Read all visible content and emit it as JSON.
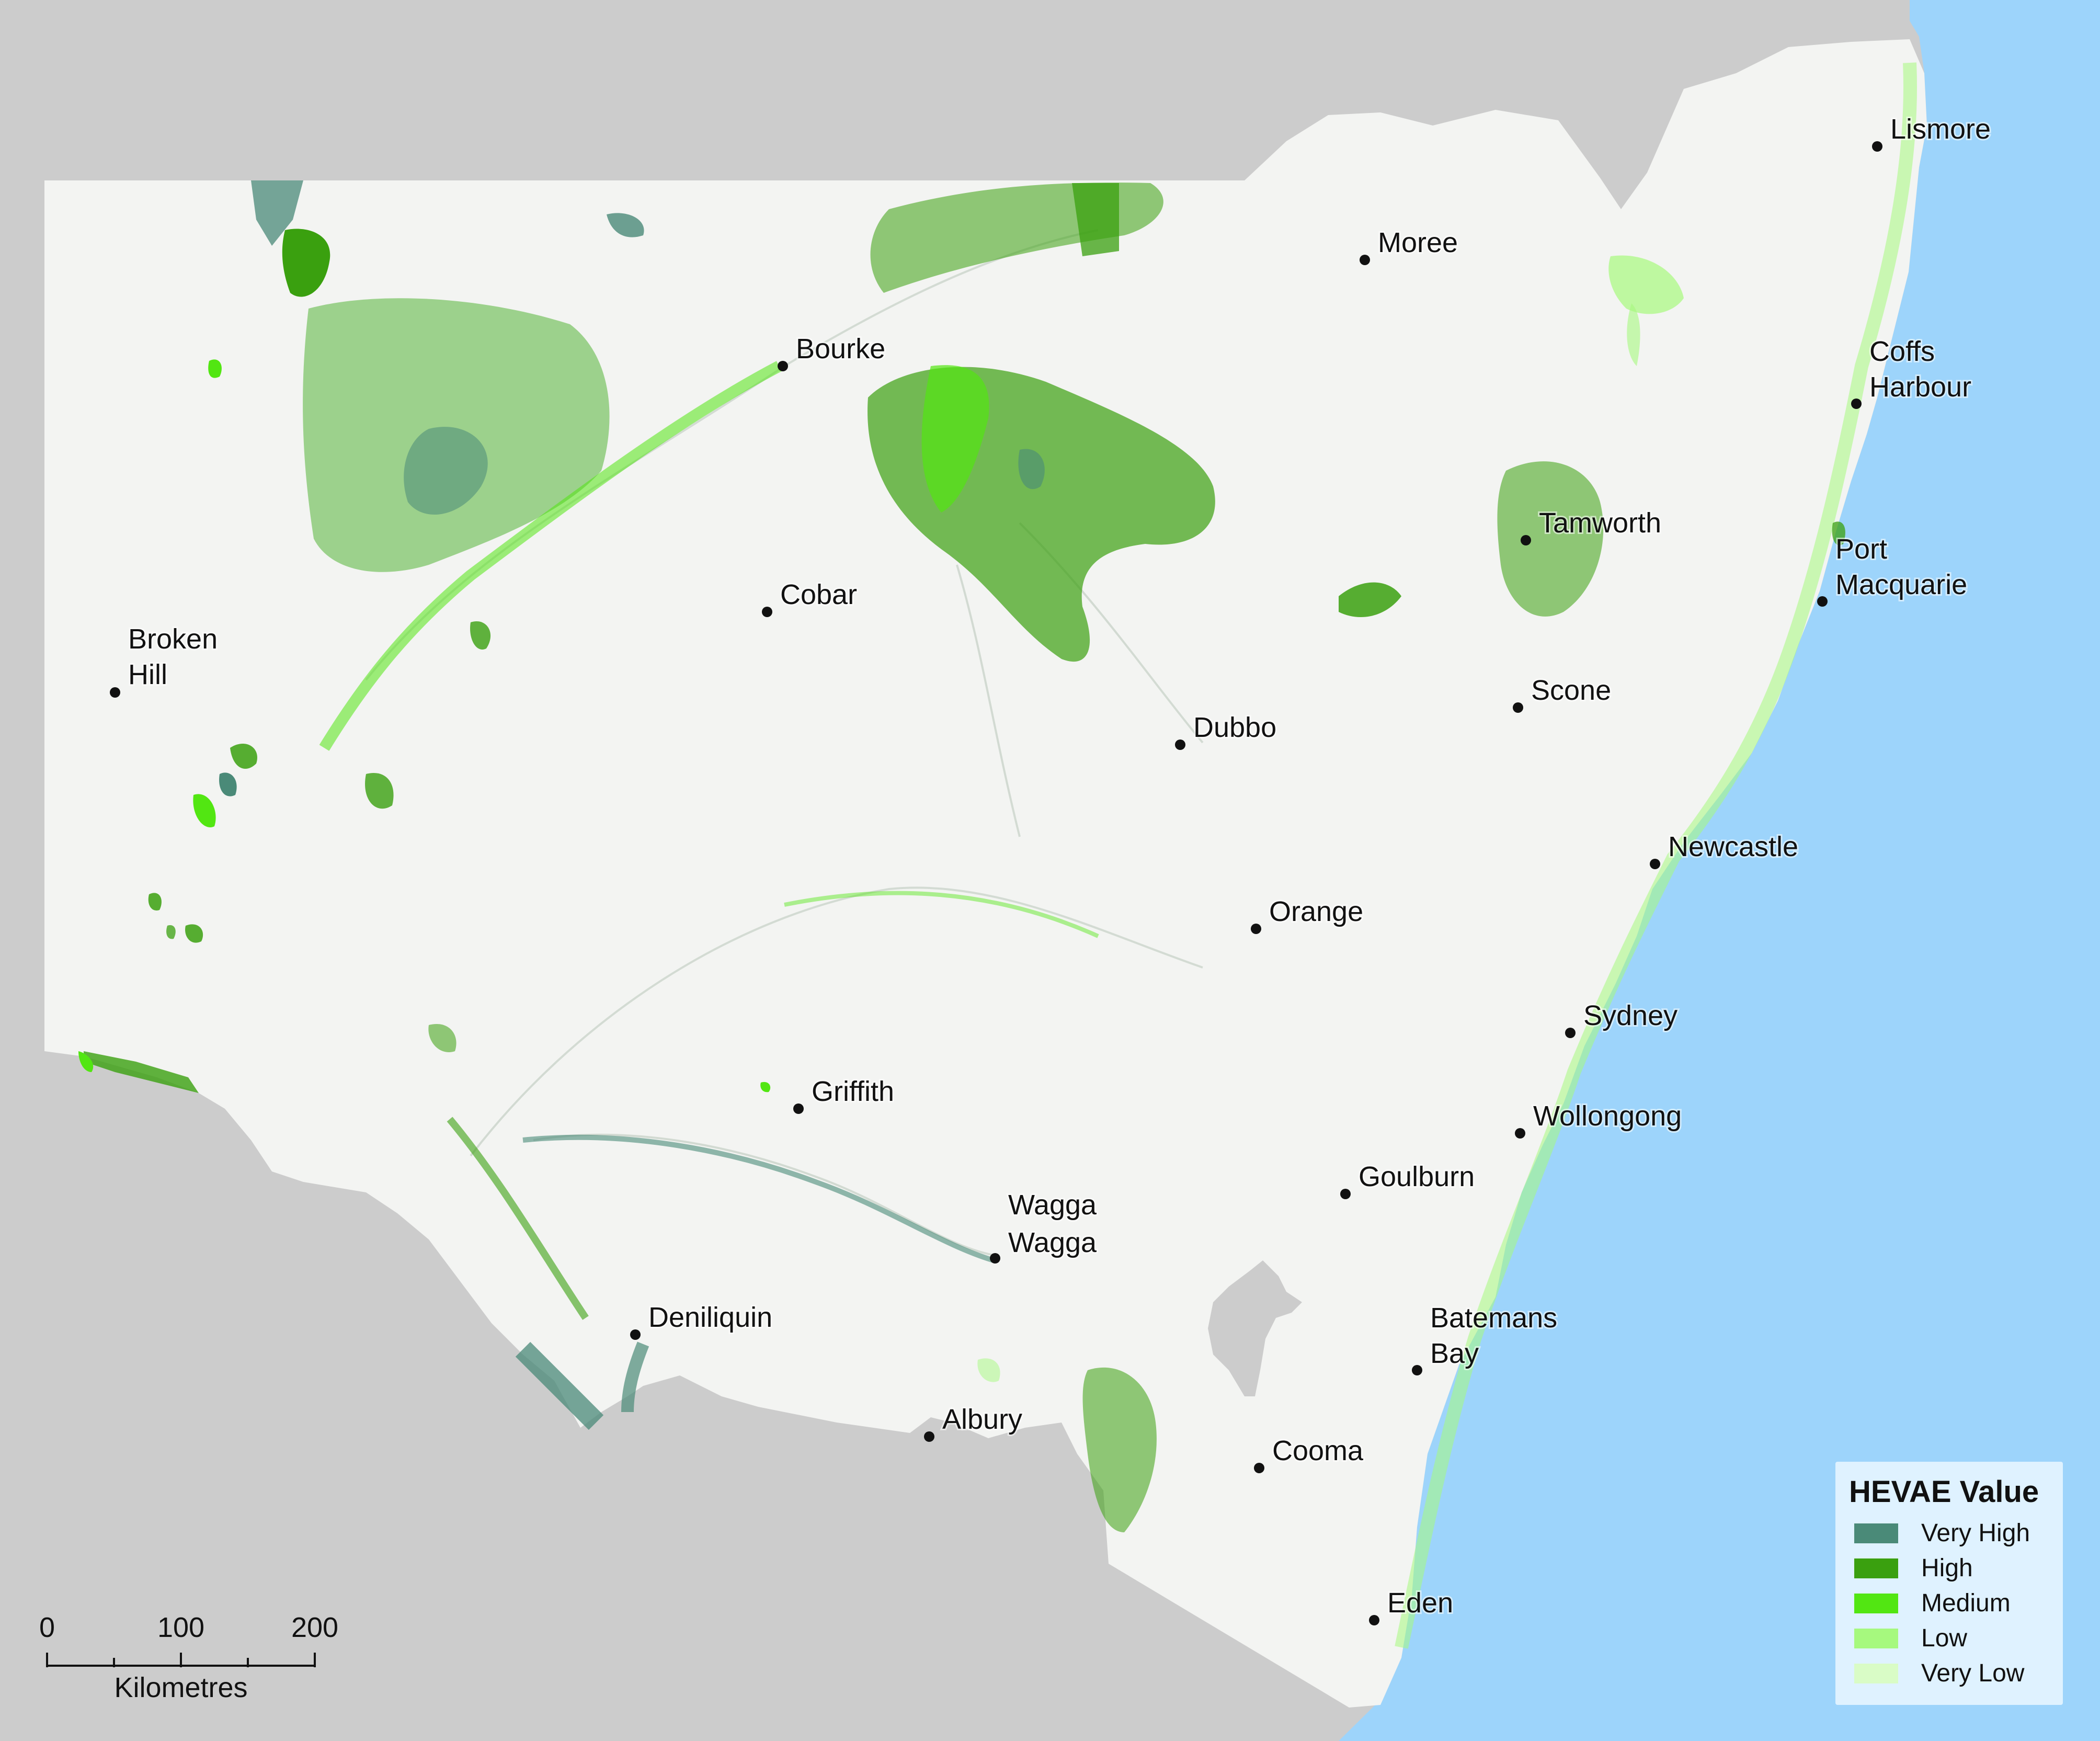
{
  "colors": {
    "background": "#cccccc",
    "ocean": "#9dd4fb",
    "land": "#f3f4f2"
  },
  "cities": [
    {
      "name": "Lismore",
      "lines": [
        "Lismore"
      ]
    },
    {
      "name": "Moree",
      "lines": [
        "Moree"
      ]
    },
    {
      "name": "Bourke",
      "lines": [
        "Bourke"
      ]
    },
    {
      "name": "Coffs Harbour",
      "lines": [
        "Coffs",
        "Harbour"
      ]
    },
    {
      "name": "Tamworth",
      "lines": [
        "Tamworth"
      ]
    },
    {
      "name": "Port Macquarie",
      "lines": [
        "Port",
        "Macquarie"
      ]
    },
    {
      "name": "Cobar",
      "lines": [
        "Cobar"
      ]
    },
    {
      "name": "Broken Hill",
      "lines": [
        "Broken",
        "Hill"
      ]
    },
    {
      "name": "Scone",
      "lines": [
        "Scone"
      ]
    },
    {
      "name": "Dubbo",
      "lines": [
        "Dubbo"
      ]
    },
    {
      "name": "Newcastle",
      "lines": [
        "Newcastle"
      ]
    },
    {
      "name": "Orange",
      "lines": [
        "Orange"
      ]
    },
    {
      "name": "Sydney",
      "lines": [
        "Sydney"
      ]
    },
    {
      "name": "Griffith",
      "lines": [
        "Griffith"
      ]
    },
    {
      "name": "Wollongong",
      "lines": [
        "Wollongong"
      ]
    },
    {
      "name": "Goulburn",
      "lines": [
        "Goulburn"
      ]
    },
    {
      "name": "Wagga Wagga",
      "lines": [
        "Wagga",
        "Wagga"
      ]
    },
    {
      "name": "Batemans Bay",
      "lines": [
        "Batemans",
        "Bay"
      ]
    },
    {
      "name": "Deniliquin",
      "lines": [
        "Deniliquin"
      ]
    },
    {
      "name": "Albury",
      "lines": [
        "Albury"
      ]
    },
    {
      "name": "Cooma",
      "lines": [
        "Cooma"
      ]
    },
    {
      "name": "Eden",
      "lines": [
        "Eden"
      ]
    }
  ],
  "legend": {
    "title": "HEVAE Value",
    "items": [
      {
        "label": "Very High",
        "color": "#4a8a78"
      },
      {
        "label": "High",
        "color": "#3aa00f"
      },
      {
        "label": "Medium",
        "color": "#52e612"
      },
      {
        "label": "Low",
        "color": "#a6f97e"
      },
      {
        "label": "Very Low",
        "color": "#d9fcc6"
      }
    ]
  },
  "scale_bar": {
    "ticks": [
      "0",
      "100",
      "200"
    ],
    "unit": "Kilometres"
  }
}
